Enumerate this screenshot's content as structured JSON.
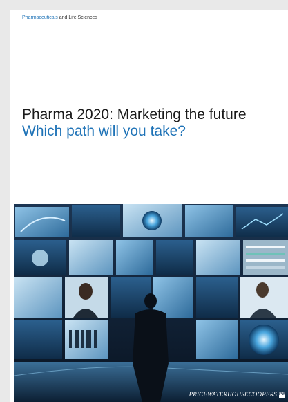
{
  "document": {
    "kicker_primary": "Pharmaceuticals",
    "kicker_secondary": " and Life Sciences",
    "title": "Pharma 2020: Marketing the future",
    "subtitle": "Which path will you take?"
  },
  "cover_image": {
    "subject": "person facing a wall of video screens",
    "logo_text": "PRICEWATERHOUSECOOPERS",
    "logo_mark_text": "PW"
  },
  "colors": {
    "accent_blue": "#1f73b7",
    "title_text": "#1a1a1a",
    "page_background": "#ffffff"
  }
}
